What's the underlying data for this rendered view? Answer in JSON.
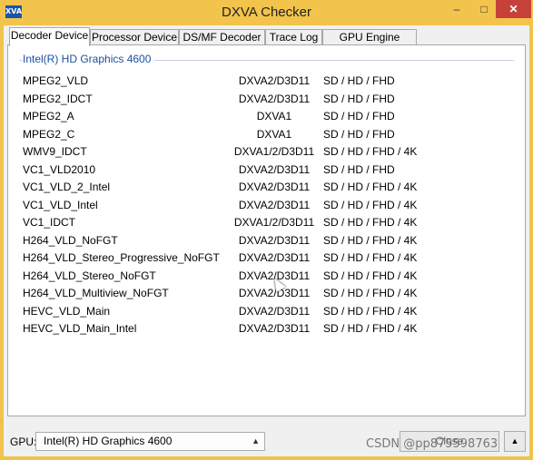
{
  "window": {
    "title": "DXVA Checker",
    "icon_text": "XVA",
    "minimize_label": "–",
    "maximize_label": "□",
    "close_label": "✕"
  },
  "tabs": [
    {
      "label": "Decoder Device"
    },
    {
      "label": "Processor Device"
    },
    {
      "label": "DS/MF Decoder"
    },
    {
      "label": "Trace Log"
    },
    {
      "label": "GPU Engine Usage"
    }
  ],
  "group": {
    "title": "Intel(R) HD Graphics 4600"
  },
  "decoders": [
    {
      "name": "MPEG2_VLD",
      "api": "DXVA2/D3D11",
      "res": "SD / HD / FHD"
    },
    {
      "name": "MPEG2_IDCT",
      "api": "DXVA2/D3D11",
      "res": "SD / HD / FHD"
    },
    {
      "name": "MPEG2_A",
      "api": "DXVA1",
      "res": "SD / HD / FHD"
    },
    {
      "name": "MPEG2_C",
      "api": "DXVA1",
      "res": "SD / HD / FHD"
    },
    {
      "name": "WMV9_IDCT",
      "api": "DXVA1/2/D3D11",
      "res": "SD / HD / FHD / 4K"
    },
    {
      "name": "VC1_VLD2010",
      "api": "DXVA2/D3D11",
      "res": "SD / HD / FHD"
    },
    {
      "name": "VC1_VLD_2_Intel",
      "api": "DXVA2/D3D11",
      "res": "SD / HD / FHD / 4K"
    },
    {
      "name": "VC1_VLD_Intel",
      "api": "DXVA2/D3D11",
      "res": "SD / HD / FHD / 4K"
    },
    {
      "name": "VC1_IDCT",
      "api": "DXVA1/2/D3D11",
      "res": "SD / HD / FHD / 4K"
    },
    {
      "name": "H264_VLD_NoFGT",
      "api": "DXVA2/D3D11",
      "res": "SD / HD / FHD / 4K"
    },
    {
      "name": "H264_VLD_Stereo_Progressive_NoFGT",
      "api": "DXVA2/D3D11",
      "res": "SD / HD / FHD / 4K"
    },
    {
      "name": "H264_VLD_Stereo_NoFGT",
      "api": "DXVA2/D3D11",
      "res": "SD / HD / FHD / 4K"
    },
    {
      "name": "H264_VLD_Multiview_NoFGT",
      "api": "DXVA2/D3D11",
      "res": "SD / HD / FHD / 4K"
    },
    {
      "name": "HEVC_VLD_Main",
      "api": "DXVA2/D3D11",
      "res": "SD / HD / FHD / 4K"
    },
    {
      "name": "HEVC_VLD_Main_Intel",
      "api": "DXVA2/D3D11",
      "res": "SD / HD / FHD / 4K"
    }
  ],
  "footer": {
    "gpu_label": "GPU:",
    "gpu_selected": "Intel(R) HD Graphics 4600",
    "close_button": "Close",
    "more_button": "▲",
    "watermark": "CSDN @pp875598763"
  }
}
